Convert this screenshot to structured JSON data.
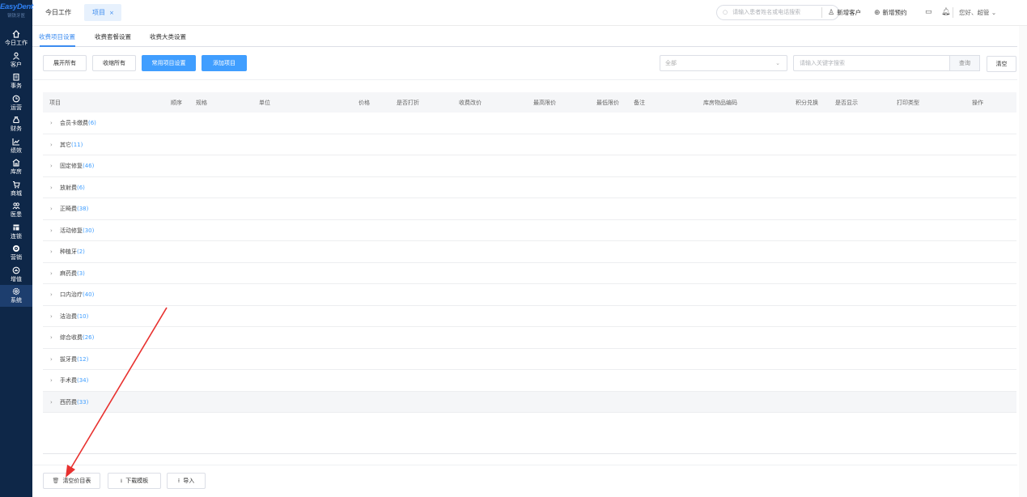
{
  "logo": {
    "brand": "EasyDent",
    "subtitle": "钢铁牙医"
  },
  "sidebar": {
    "items": [
      {
        "label": "今日工作",
        "icon": "home-icon"
      },
      {
        "label": "客户",
        "icon": "user-icon"
      },
      {
        "label": "事务",
        "icon": "clipboard-icon"
      },
      {
        "label": "运营",
        "icon": "clock-icon"
      },
      {
        "label": "财务",
        "icon": "money-bag-icon"
      },
      {
        "label": "绩效",
        "icon": "chart-line-icon"
      },
      {
        "label": "库房",
        "icon": "warehouse-icon"
      },
      {
        "label": "商城",
        "icon": "cart-icon"
      },
      {
        "label": "医患",
        "icon": "doctor-patient-icon"
      },
      {
        "label": "连锁",
        "icon": "chain-store-icon"
      },
      {
        "label": "营销",
        "icon": "marketing-icon"
      },
      {
        "label": "增值",
        "icon": "value-added-icon"
      },
      {
        "label": "系统",
        "icon": "gear-icon",
        "active": true
      }
    ]
  },
  "topbar": {
    "tab_home": "今日工作",
    "tab_project": "项目",
    "tab_close": "×",
    "search_placeholder": "请输入患者姓名或电话搜索",
    "new_customer": "新增客户",
    "new_appointment": "新增预约",
    "greeting": "您好、超管"
  },
  "subtabs": {
    "items": [
      "收费项目设置",
      "收费套餐设置",
      "收费大类设置"
    ],
    "active_index": 0
  },
  "toolbar": {
    "expand_all": "展开所有",
    "collapse_all": "收缩所有",
    "common_items": "常用项目设置",
    "add_item": "添加项目",
    "category_select": "全部",
    "keyword_placeholder": "请输入关键字搜索",
    "query": "查询",
    "clear": "清空"
  },
  "table": {
    "headers": [
      "项目",
      "顺序",
      "规格",
      "单位",
      "价格",
      "是否打折",
      "收费改价",
      "最高限价",
      "最低限价",
      "备注",
      "库房物品编码",
      "积分兑换",
      "是否显示",
      "打印类型",
      "操作"
    ],
    "groups": [
      {
        "name": "会员卡缴费",
        "count": "(6)"
      },
      {
        "name": "其它",
        "count": "(11)"
      },
      {
        "name": "固定修复",
        "count": "(46)"
      },
      {
        "name": "放射费",
        "count": "(6)"
      },
      {
        "name": "正畸费",
        "count": "(38)"
      },
      {
        "name": "活动修复",
        "count": "(30)"
      },
      {
        "name": "种植牙",
        "count": "(2)"
      },
      {
        "name": "麻药费",
        "count": "(3)"
      },
      {
        "name": "口内治疗",
        "count": "(40)"
      },
      {
        "name": "洁治费",
        "count": "(10)"
      },
      {
        "name": "综合收费",
        "count": "(26)"
      },
      {
        "name": "拔牙费",
        "count": "(12)"
      },
      {
        "name": "手术费",
        "count": "(34)"
      },
      {
        "name": "西药费",
        "count": "(33)"
      }
    ],
    "hovered_index": 13
  },
  "footer": {
    "clear_price_list": "清空价目表",
    "download_template": "下载模板",
    "import": "导入"
  },
  "colors": {
    "sidebar_bg": "#0e2748",
    "primary": "#409eff",
    "annotation": "#e8312f"
  }
}
